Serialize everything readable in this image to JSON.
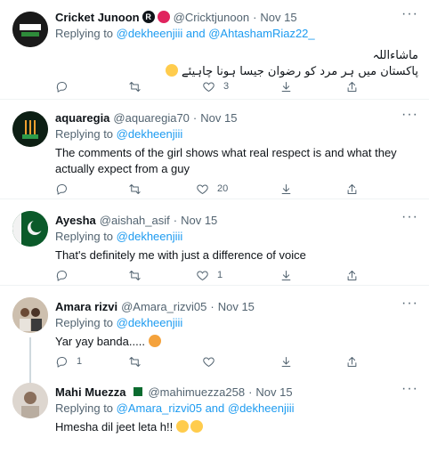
{
  "tweets": [
    {
      "name": "Cricket Junoon",
      "badge": "R",
      "handle": "@Cricktjunoon",
      "date": "Nov 15",
      "replying_prefix": "Replying to",
      "replying_to": "@dekheenjiii and @AhtashamRiaz22_",
      "text_line1": "ماشاءاللہ",
      "text_line2": "پاکستان میں ہر مرد کو رضوان جیسا ہونا چاہیئے",
      "counts": {
        "reply": "",
        "retweet": "",
        "like": "3"
      }
    },
    {
      "name": "aquaregia",
      "handle": "@aquaregia70",
      "date": "Nov 15",
      "replying_prefix": "Replying to",
      "replying_to": "@dekheenjiii",
      "text": "The comments of the girl shows what real respect is and what they actually expect from a guy",
      "counts": {
        "reply": "",
        "retweet": "",
        "like": "20"
      }
    },
    {
      "name": "Ayesha",
      "handle": "@aishah_asif",
      "date": "Nov 15",
      "replying_prefix": "Replying to",
      "replying_to": "@dekheenjiii",
      "text": "That's definitely me with just a difference of voice",
      "counts": {
        "reply": "",
        "retweet": "",
        "like": "1"
      }
    },
    {
      "name": "Amara rizvi",
      "handle": "@Amara_rizvi05",
      "date": "Nov 15",
      "replying_prefix": "Replying to",
      "replying_to": "@dekheenjiii",
      "text": "Yar yay banda.....",
      "counts": {
        "reply": "1",
        "retweet": "",
        "like": ""
      }
    },
    {
      "name": "Mahi Muezza",
      "handle": "@mahimuezza258",
      "date": "Nov 15",
      "replying_prefix": "Replying to",
      "replying_to": "@Amara_rizvi05 and @dekheenjiii",
      "text": "Hmesha dil jeet leta h!!",
      "counts": {
        "reply": "",
        "retweet": "",
        "like": ""
      }
    }
  ],
  "more_label": "···",
  "colors": {
    "link": "#1d9bf0",
    "muted": "#536471",
    "text": "#0f1419",
    "divider": "#eff3f4"
  }
}
